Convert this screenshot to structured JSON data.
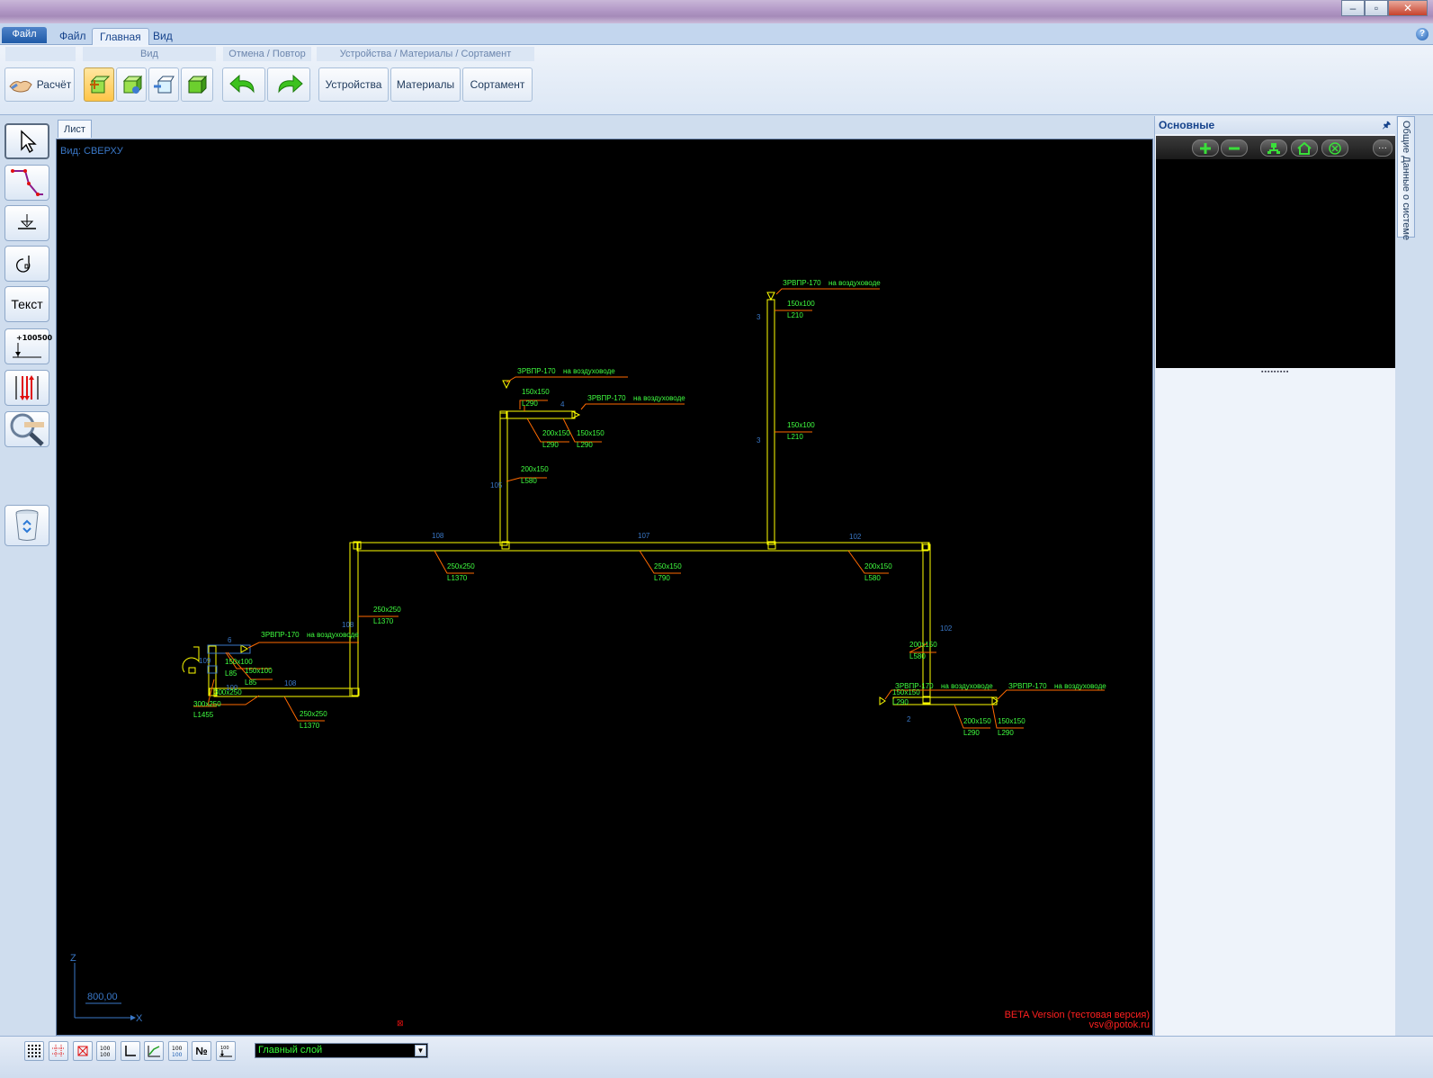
{
  "ribbon": {
    "tabs": {
      "file_menu": "Файл",
      "file": "Файл",
      "home": "Главная",
      "view": "Вид"
    },
    "groups": {
      "view": "Вид",
      "undo_redo": "Отмена / Повтор",
      "devices": "Устройства / Материалы / Сортамент"
    },
    "buttons": {
      "calc": "Расчёт",
      "devices": "Устройства",
      "materials": "Материалы",
      "assortment": "Сортамент"
    }
  },
  "left_tools": {
    "text": "Текст",
    "elevation": "+100500"
  },
  "document": {
    "tab": "Лист",
    "view_label": "Вид: СВЕРХУ",
    "axis_z": "Z",
    "axis_x": "X",
    "scale": "800,00",
    "beta": "BETA Version (тестовая версия)",
    "email": "vsv@potok.ru"
  },
  "right_panel": {
    "title": "Основные",
    "side_tab": "Общие Данные о системе"
  },
  "status": {
    "layer": "Главный слой",
    "number_sign": "№"
  },
  "drawing": {
    "nodes": [
      "108",
      "107",
      "102",
      "105",
      "6",
      "4",
      "3",
      "3",
      "102",
      "2",
      "108",
      "108",
      "109",
      "100"
    ],
    "labels": [
      "ЗРВПР-170",
      "на воздуховоде",
      "ЗРВПР-170",
      "на воздуховоде",
      "ЗРВПР-170",
      "на воздуховоде",
      "ЗРВПР-170",
      "на воздуховоде",
      "ЗРВПР-170",
      "на воздуховоде",
      "ЗРВПР-170",
      "на воздуховоде",
      "150x150",
      "L290",
      "200x150",
      "L290",
      "150x150",
      "L290",
      "200x150",
      "L580",
      "150x100",
      "L210",
      "150x100",
      "L210",
      "250x250",
      "L1370",
      "250x150",
      "L790",
      "200x150",
      "L580",
      "250x250",
      "L1370",
      "200x150",
      "L580",
      "150x150",
      "L290",
      "200x150",
      "L290",
      "150x150",
      "L290",
      "150x100",
      "L85",
      "150x100",
      "L85",
      "300x250",
      "300x250",
      "L1455",
      "250x250",
      "L1370"
    ]
  },
  "colors": {
    "duct": "#ffff00",
    "label": "#40ff40",
    "leader": "#ff6a00",
    "node": "#3a78c8",
    "canvas": "#000000",
    "beta": "#ff2020"
  }
}
